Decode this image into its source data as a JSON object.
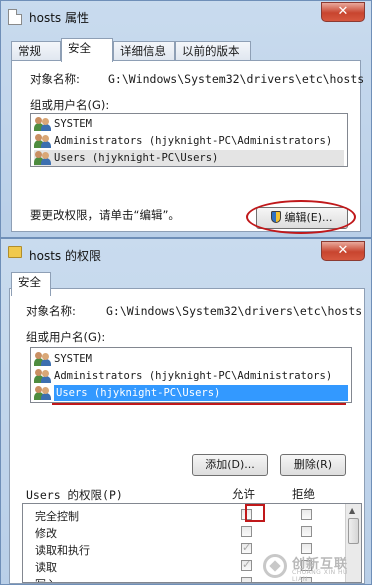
{
  "props_window": {
    "title": "hosts 属性",
    "close_label": "✕",
    "tabs": [
      "常规",
      "安全",
      "详细信息",
      "以前的版本"
    ],
    "object_label": "对象名称:",
    "object_value": "G:\\Windows\\System32\\drivers\\etc\\hosts",
    "groups_label": "组或用户名(G):",
    "users": [
      "SYSTEM",
      "Administrators (hjyknight-PC\\Administrators)",
      "Users (hjyknight-PC\\Users)"
    ],
    "hint": "要更改权限，请单击“编辑”。",
    "edit_button": "编辑(E)..."
  },
  "perm_window": {
    "title": "hosts 的权限",
    "close_label": "✕",
    "tab": "安全",
    "object_label": "对象名称:",
    "object_value": "G:\\Windows\\System32\\drivers\\etc\\hosts",
    "groups_label": "组或用户名(G):",
    "users": [
      "SYSTEM",
      "Administrators (hjyknight-PC\\Administrators)",
      "Users (hjyknight-PC\\Users)"
    ],
    "add_button": "添加(D)...",
    "remove_button": "删除(R)",
    "perm_header": "Users 的权限(P)",
    "allow_header": "允许",
    "deny_header": "拒绝",
    "permissions": [
      {
        "name": "完全控制",
        "allow": false,
        "deny": false
      },
      {
        "name": "修改",
        "allow": false,
        "deny": false
      },
      {
        "name": "读取和执行",
        "allow": true,
        "deny": false
      },
      {
        "name": "读取",
        "allow": true,
        "deny": false
      },
      {
        "name": "写入",
        "allow": false,
        "deny": false
      }
    ]
  },
  "watermark": {
    "name": "创新互联",
    "sub": "CHUANG XIN HU LIAN"
  },
  "colors": {
    "selection": "#3399ff",
    "annotation_red": "#c0181a",
    "frame": "#b9cfe8"
  }
}
